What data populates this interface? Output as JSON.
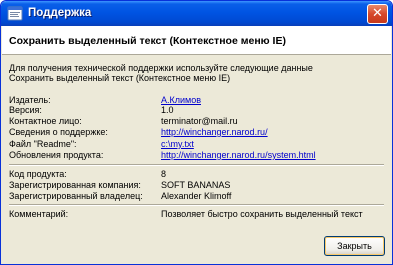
{
  "window": {
    "title": "Поддержка",
    "close_glyph": "✕"
  },
  "header": {
    "title": "Сохранить выделенный текст (Контекстное меню IE)"
  },
  "intro": {
    "line1": "Для получения технической поддержки используйте следующие данные",
    "line2": "Сохранить выделенный текст (Контекстное меню IE)"
  },
  "details": [
    {
      "label": "Издатель:",
      "value": "A.Климов",
      "link": true
    },
    {
      "label": "Версия:",
      "value": "1.0",
      "link": false
    },
    {
      "label": "Контактное лицо:",
      "value": "terminator@mail.ru",
      "link": false
    },
    {
      "label": "Сведения о поддержке:",
      "value": "http://winchanger.narod.ru/",
      "link": true
    },
    {
      "label": "Файл \"Readme\":",
      "value": "c:\\my.txt",
      "link": true
    },
    {
      "label": "Обновления продукта:",
      "value": "http://winchanger.narod.ru/system.html",
      "link": true
    }
  ],
  "registration": [
    {
      "label": "Код продукта:",
      "value": "8"
    },
    {
      "label": "Зарегистрированная компания:",
      "value": "SOFT BANANAS"
    },
    {
      "label": "Зарегистрированный владелец:",
      "value": "Alexander Klimoff"
    }
  ],
  "comment": {
    "label": "Комментарий:",
    "value": "Позволяет быстро сохранить выделенный текст"
  },
  "buttons": {
    "close_label": "Закрыть"
  },
  "colors": {
    "titlebar": "#0054e3",
    "link": "#0000cc",
    "dialog_bg": "#ece9d8"
  }
}
